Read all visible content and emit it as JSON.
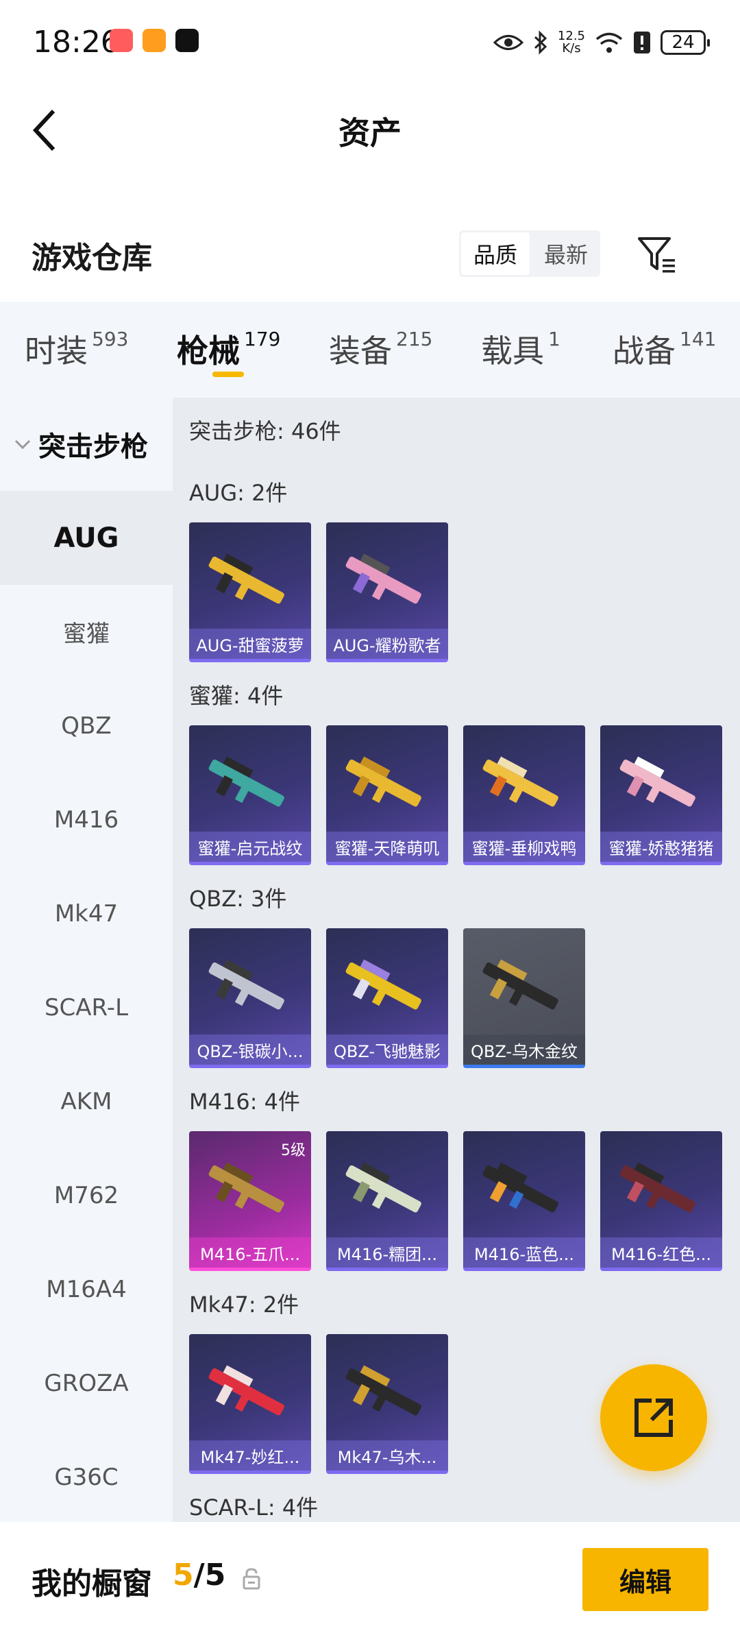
{
  "status_bar": {
    "time": "18:26",
    "speed_value": "12.5",
    "speed_unit": "K/s",
    "battery": "24"
  },
  "header": {
    "title": "资产"
  },
  "warehouse": {
    "title": "游戏仓库",
    "sort_options": [
      "品质",
      "最新"
    ],
    "active_sort": "品质"
  },
  "categories": [
    {
      "label": "时装",
      "count": "593"
    },
    {
      "label": "枪械",
      "count": "179",
      "active": true
    },
    {
      "label": "装备",
      "count": "215"
    },
    {
      "label": "载具",
      "count": "1"
    },
    {
      "label": "战备",
      "count": "141"
    }
  ],
  "sidebar": {
    "group": "突击步枪",
    "items": [
      "AUG",
      "蜜獾",
      "QBZ",
      "M416",
      "Mk47",
      "SCAR-L",
      "AKM",
      "M762",
      "M16A4",
      "GROZA",
      "G36C"
    ],
    "active": "AUG"
  },
  "content": {
    "total": "突击步枪: 46件",
    "sections": [
      {
        "label": "AUG: 2件",
        "items": [
          "AUG-甜蜜菠萝",
          "AUG-耀粉歌者"
        ]
      },
      {
        "label": "蜜獾: 4件",
        "items": [
          "蜜獾-启元战纹",
          "蜜獾-天降萌叽",
          "蜜獾-垂柳戏鸭",
          "蜜獾-娇憨猪猪"
        ]
      },
      {
        "label": "QBZ: 3件",
        "items": [
          "QBZ-银碳小...",
          "QBZ-飞驰魅影",
          "QBZ-乌木金纹"
        ]
      },
      {
        "label": "M416: 4件",
        "items": [
          "M416-五爪...",
          "M416-糯团...",
          "M416-蓝色...",
          "M416-红色..."
        ],
        "level_badge": "5级"
      },
      {
        "label": "Mk47: 2件",
        "items": [
          "Mk47-妙红...",
          "Mk47-乌木..."
        ]
      },
      {
        "label": "SCAR-L: 4件",
        "items": []
      }
    ]
  },
  "bottom_bar": {
    "label": "我的橱窗",
    "count_used": "5",
    "count_sep": "/",
    "count_total": "5",
    "edit_label": "编辑"
  },
  "colors": {
    "accent": "#f7b500",
    "card_purple": "#3b3778",
    "card_pink": "#d23ac4",
    "card_gray": "#585c68"
  },
  "icons": [
    "back-arrow-icon",
    "filter-icon",
    "chevron-down-icon",
    "share-icon",
    "lock-icon",
    "eye-icon",
    "bluetooth-icon",
    "wifi-icon",
    "battery-icon"
  ]
}
